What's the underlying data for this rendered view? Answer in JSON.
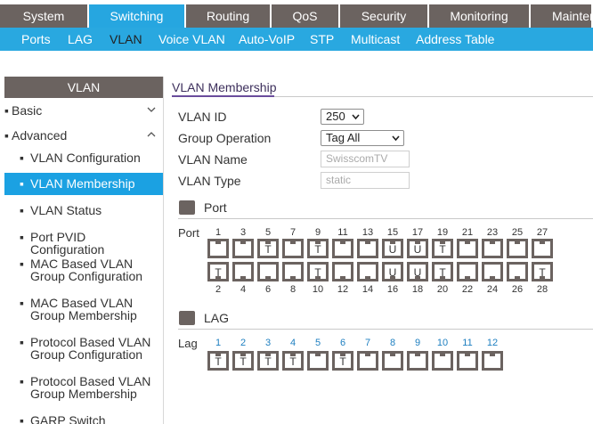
{
  "topnav": [
    "System",
    "Switching",
    "Routing",
    "QoS",
    "Security",
    "Monitoring",
    "Maintenance"
  ],
  "subnav": [
    "Ports",
    "LAG",
    "VLAN",
    "Voice VLAN",
    "Auto-VoIP",
    "STP",
    "Multicast",
    "Address Table"
  ],
  "sidebar": {
    "header": "VLAN",
    "basic": "Basic",
    "advanced": "Advanced",
    "items": [
      "VLAN Configuration",
      "VLAN Membership",
      "VLAN Status",
      "Port PVID Configuration",
      "MAC Based VLAN\nGroup Configuration",
      "MAC Based VLAN\nGroup Membership",
      "Protocol Based VLAN\nGroup Configuration",
      "Protocol Based VLAN\nGroup Membership",
      "GARP Switch"
    ],
    "active_index": 1
  },
  "main": {
    "title": "VLAN Membership",
    "vlan_id_label": "VLAN ID",
    "vlan_id_value": "250",
    "group_op_label": "Group Operation",
    "group_op_value": "Tag All",
    "vlan_name_label": "VLAN Name",
    "vlan_name_value": "SwisscomTV",
    "vlan_type_label": "VLAN Type",
    "vlan_type_value": "static",
    "port_section": "Port",
    "port_row_label": "Port",
    "lag_section": "LAG",
    "lag_row_label": "Lag"
  },
  "ports_top": [
    {
      "n": "1",
      "tag": ""
    },
    {
      "n": "3",
      "tag": ""
    },
    {
      "n": "5",
      "tag": "T"
    },
    {
      "n": "7",
      "tag": ""
    },
    {
      "n": "9",
      "tag": "T"
    },
    {
      "n": "11",
      "tag": ""
    },
    {
      "n": "13",
      "tag": ""
    },
    {
      "n": "15",
      "tag": "U"
    },
    {
      "n": "17",
      "tag": "U"
    },
    {
      "n": "19",
      "tag": "T"
    },
    {
      "n": "21",
      "tag": ""
    },
    {
      "n": "23",
      "tag": ""
    },
    {
      "n": "25",
      "tag": ""
    },
    {
      "n": "27",
      "tag": ""
    }
  ],
  "ports_bottom": [
    {
      "n": "2",
      "tag": "T"
    },
    {
      "n": "4",
      "tag": ""
    },
    {
      "n": "6",
      "tag": ""
    },
    {
      "n": "8",
      "tag": ""
    },
    {
      "n": "10",
      "tag": "T"
    },
    {
      "n": "12",
      "tag": ""
    },
    {
      "n": "14",
      "tag": ""
    },
    {
      "n": "16",
      "tag": "U"
    },
    {
      "n": "18",
      "tag": "U"
    },
    {
      "n": "20",
      "tag": "T"
    },
    {
      "n": "22",
      "tag": ""
    },
    {
      "n": "24",
      "tag": ""
    },
    {
      "n": "26",
      "tag": ""
    },
    {
      "n": "28",
      "tag": "T"
    }
  ],
  "lags": [
    {
      "n": "1",
      "tag": "T"
    },
    {
      "n": "2",
      "tag": "T"
    },
    {
      "n": "3",
      "tag": "T"
    },
    {
      "n": "4",
      "tag": "T"
    },
    {
      "n": "5",
      "tag": ""
    },
    {
      "n": "6",
      "tag": "T"
    },
    {
      "n": "7",
      "tag": ""
    },
    {
      "n": "8",
      "tag": ""
    },
    {
      "n": "9",
      "tag": ""
    },
    {
      "n": "10",
      "tag": ""
    },
    {
      "n": "11",
      "tag": ""
    },
    {
      "n": "12",
      "tag": ""
    }
  ],
  "icons": {
    "collapse": "chevron-down-icon",
    "expand": "chevron-up-icon",
    "select": "caret-down-icon",
    "section": "port-icon"
  }
}
